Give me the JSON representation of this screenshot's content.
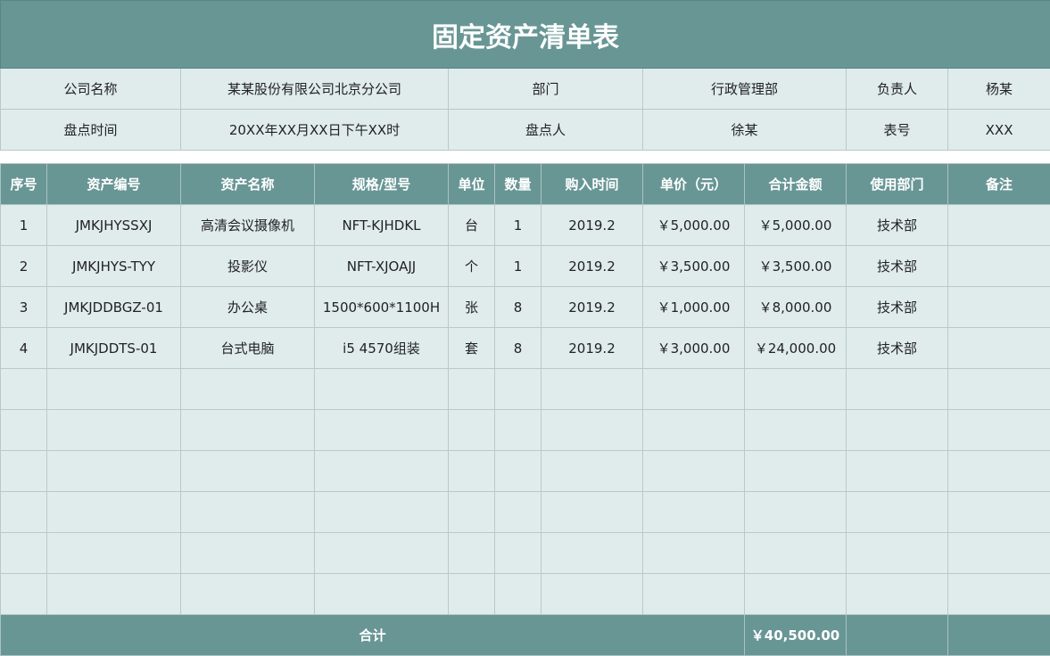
{
  "title": "固定资产清单表",
  "info": {
    "company_label": "公司名称",
    "company_value": "某某股份有限公司北京分公司",
    "dept_label": "部门",
    "dept_value": "行政管理部",
    "owner_label": "负责人",
    "owner_value": "杨某",
    "time_label": "盘点时间",
    "time_value": "20XX年XX月XX日下午XX时",
    "checker_label": "盘点人",
    "checker_value": "徐某",
    "sheet_no_label": "表号",
    "sheet_no_value": "XXX"
  },
  "columns": [
    "序号",
    "资产编号",
    "资产名称",
    "规格/型号",
    "单位",
    "数量",
    "购入时间",
    "单价（元）",
    "合计金额",
    "使用部门",
    "备注"
  ],
  "rows": [
    {
      "no": "1",
      "code": "JMKJHYSSXJ",
      "name": "高清会议摄像机",
      "spec": "NFT-KJHDKL",
      "unit": "台",
      "qty": "1",
      "date": "2019.2",
      "price": "￥5,000.00",
      "amount": "￥5,000.00",
      "dept": "技术部",
      "note": ""
    },
    {
      "no": "2",
      "code": "JMKJHYS-TYY",
      "name": "投影仪",
      "spec": "NFT-XJOAJJ",
      "unit": "个",
      "qty": "1",
      "date": "2019.2",
      "price": "￥3,500.00",
      "amount": "￥3,500.00",
      "dept": "技术部",
      "note": ""
    },
    {
      "no": "3",
      "code": "JMKJDDBGZ-01",
      "name": "办公桌",
      "spec": "1500*600*1100H",
      "unit": "张",
      "qty": "8",
      "date": "2019.2",
      "price": "￥1,000.00",
      "amount": "￥8,000.00",
      "dept": "技术部",
      "note": ""
    },
    {
      "no": "4",
      "code": "JMKJDDTS-01",
      "name": "台式电脑",
      "spec": "i5 4570组装",
      "unit": "套",
      "qty": "8",
      "date": "2019.2",
      "price": "￥3,000.00",
      "amount": "￥24,000.00",
      "dept": "技术部",
      "note": ""
    },
    {
      "no": "",
      "code": "",
      "name": "",
      "spec": "",
      "unit": "",
      "qty": "",
      "date": "",
      "price": "",
      "amount": "",
      "dept": "",
      "note": ""
    },
    {
      "no": "",
      "code": "",
      "name": "",
      "spec": "",
      "unit": "",
      "qty": "",
      "date": "",
      "price": "",
      "amount": "",
      "dept": "",
      "note": ""
    },
    {
      "no": "",
      "code": "",
      "name": "",
      "spec": "",
      "unit": "",
      "qty": "",
      "date": "",
      "price": "",
      "amount": "",
      "dept": "",
      "note": ""
    },
    {
      "no": "",
      "code": "",
      "name": "",
      "spec": "",
      "unit": "",
      "qty": "",
      "date": "",
      "price": "",
      "amount": "",
      "dept": "",
      "note": ""
    },
    {
      "no": "",
      "code": "",
      "name": "",
      "spec": "",
      "unit": "",
      "qty": "",
      "date": "",
      "price": "",
      "amount": "",
      "dept": "",
      "note": ""
    },
    {
      "no": "",
      "code": "",
      "name": "",
      "spec": "",
      "unit": "",
      "qty": "",
      "date": "",
      "price": "",
      "amount": "",
      "dept": "",
      "note": ""
    }
  ],
  "total": {
    "label": "合计",
    "amount": "￥40,500.00"
  },
  "colors": {
    "header_bg": "#689695",
    "cell_bg": "#e0ecec",
    "border": "#b9c9c7"
  }
}
